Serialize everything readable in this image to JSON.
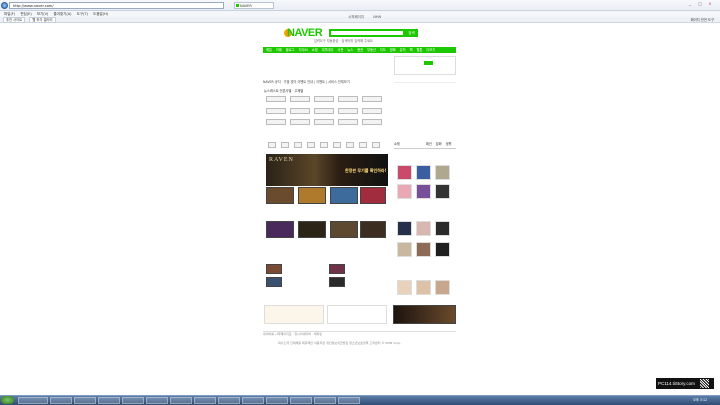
{
  "browser": {
    "address": "http://www.naver.com/",
    "tab_title": "NAVER",
    "menu": [
      "파일(F)",
      "편집(E)",
      "보기(V)",
      "즐겨찾기(A)",
      "도구(T)",
      "도움말(H)"
    ],
    "favorites": [
      "추천 사이트",
      "웹 조각 갤러리"
    ],
    "tools": [
      "페이지",
      "안전",
      "도구"
    ]
  },
  "naver": {
    "toplinks": [
      "시작페이지",
      "NHN"
    ],
    "logo": "NAVER",
    "search_button": "검색",
    "search_hint": "입력도구  자동완성  ·  검색어를 입력해 주세요",
    "gnb": [
      "메일",
      "카페",
      "블로그",
      "지식iN",
      "쇼핑",
      "미투데이",
      "사전",
      "뉴스",
      "증권",
      "부동산",
      "지도",
      "영화",
      "뮤직",
      "책",
      "웹툰",
      "더보기"
    ],
    "notice": "NAVER 공지 · 가을 맞이 이벤트 안내  |  이벤트  |  서비스 전체보기",
    "news_header": "뉴스캐스트   언론사별 · 주제별",
    "ad_brand": "RAVEN",
    "ad_copy": "한정판 무기를 확인하라!",
    "right_section": "쇼핑",
    "right_tabs": [
      "패션",
      "잡화",
      "생활"
    ],
    "footer": "네이버를 시작페이지로 · 쥬니어네이버 · 해피빈",
    "footer_links": [
      "회사소개",
      "인재채용",
      "제휴제안",
      "이용약관",
      "개인정보취급방침",
      "청소년보호정책",
      "고객센터",
      "© NHN Corp."
    ]
  },
  "taskbar": {
    "clock": "오후 3:12"
  },
  "watermark": "PC114.tiStory.com"
}
